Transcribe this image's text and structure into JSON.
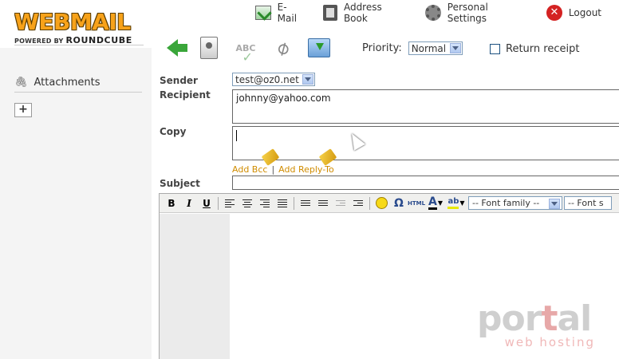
{
  "logo": {
    "main": "WEBMAIL",
    "powered": "POWERED BY",
    "brand": "ROUNDCUBE"
  },
  "topnav": {
    "email": "E-Mail",
    "address_book": "Address Book",
    "personal_settings": "Personal Settings",
    "logout": "Logout",
    "logout_glyph": "✕"
  },
  "sidebar": {
    "attachments": "Attachments",
    "clip_glyph": "🖇",
    "add": "+"
  },
  "toolbar": {
    "abc": "ABC",
    "clip_glyph": "⌀",
    "priority_label": "Priority:",
    "priority_value": "Normal",
    "return_receipt": "Return receipt"
  },
  "form": {
    "sender_label": "Sender",
    "sender_value": "test@oz0.net",
    "recipient_label": "Recipient",
    "recipient_value": "johnny@yahoo.com",
    "copy_label": "Copy",
    "copy_value": "",
    "add_bcc": "Add Bcc",
    "link_sep": "|",
    "add_reply_to": "Add Reply-To",
    "subject_label": "Subject",
    "subject_value": ""
  },
  "editor": {
    "bold": "B",
    "italic": "I",
    "underline": "U",
    "omega": "Ω",
    "html": "HTML",
    "font_a": "A",
    "ab": "ab",
    "dropdown": "▼",
    "font_family": "-- Font family --",
    "font_size": "-- Font s"
  },
  "watermark": {
    "portal_a": "por",
    "portal_t": "t",
    "portal_b": "al",
    "hosting": "web hosting"
  },
  "colors": {
    "accent": "#f7a21a",
    "link": "#d08c00",
    "panel": "#f4f4f4"
  }
}
